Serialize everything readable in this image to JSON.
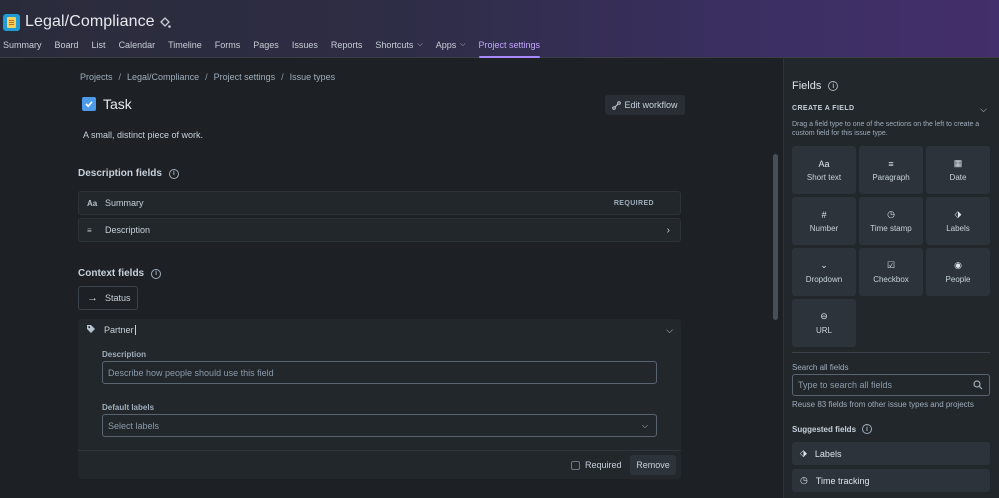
{
  "app": {
    "project_title": "Legal/Compliance",
    "nav": [
      {
        "label": "Summary"
      },
      {
        "label": "Board"
      },
      {
        "label": "List"
      },
      {
        "label": "Calendar"
      },
      {
        "label": "Timeline"
      },
      {
        "label": "Forms"
      },
      {
        "label": "Pages"
      },
      {
        "label": "Issues"
      },
      {
        "label": "Reports"
      },
      {
        "label": "Shortcuts"
      },
      {
        "label": "Apps"
      },
      {
        "label": "Project settings"
      }
    ],
    "active_tab": "Project settings",
    "accent_color": "#a788ff"
  },
  "breadcrumb": [
    "Projects",
    "Legal/Compliance",
    "Project settings",
    "Issue types"
  ],
  "issue_type": {
    "title": "Task",
    "description": "A small, distinct piece of work.",
    "edit_workflow_label": "Edit workflow",
    "icon_color": "#4d9be8"
  },
  "description_fields": {
    "title": "Description fields",
    "rows": [
      {
        "icon": "Aa",
        "label": "Summary",
        "badge": "REQUIRED"
      },
      {
        "icon": "≡",
        "label": "Description"
      }
    ]
  },
  "context_fields": {
    "title": "Context fields",
    "status_label": "Status",
    "partner": {
      "name": "Partner",
      "description_label": "Description",
      "description_placeholder": "Describe how people should use this field",
      "default_labels_label": "Default labels",
      "default_labels_placeholder": "Select labels",
      "required_label": "Required",
      "required_checked": false,
      "remove_label": "Remove"
    }
  },
  "panel": {
    "title": "Fields",
    "create_title": "CREATE A FIELD",
    "create_desc": "Drag a field type to one of the sections on the left to create a custom field for this issue type.",
    "field_types": [
      {
        "icon": "Aa",
        "label": "Short text"
      },
      {
        "icon": "≡",
        "label": "Paragraph"
      },
      {
        "icon": "▦",
        "label": "Date"
      },
      {
        "icon": "#",
        "label": "Number"
      },
      {
        "icon": "◷",
        "label": "Time stamp"
      },
      {
        "icon": "⬗",
        "label": "Labels"
      },
      {
        "icon": "⌄",
        "label": "Dropdown"
      },
      {
        "icon": "☑",
        "label": "Checkbox"
      },
      {
        "icon": "◉",
        "label": "People"
      },
      {
        "icon": "⊖",
        "label": "URL"
      }
    ],
    "search_label": "Search all fields",
    "search_placeholder": "Type to search all fields",
    "reuse_text": "Reuse 83 fields from other issue types and projects",
    "suggested_title": "Suggested fields",
    "suggested": [
      {
        "icon": "⬗",
        "label": "Labels"
      },
      {
        "icon": "◷",
        "label": "Time tracking"
      }
    ]
  }
}
